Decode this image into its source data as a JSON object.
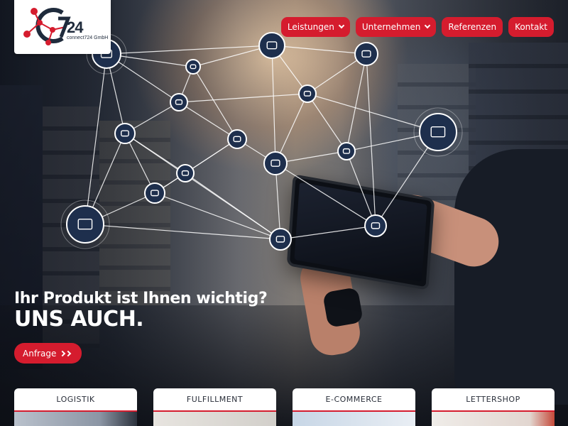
{
  "brand": {
    "logo_number": "24",
    "logo_subtitle": "connect724 GmbH",
    "logo_letters": "C7",
    "colors": {
      "accent": "#d51c2e",
      "navy": "#1f2b3c",
      "network_node": "#1e2f4d"
    }
  },
  "nav": {
    "items": [
      {
        "label": "Leistungen",
        "has_dropdown": true
      },
      {
        "label": "Unternehmen",
        "has_dropdown": true
      },
      {
        "label": "Referenzen",
        "has_dropdown": false
      },
      {
        "label": "Kontakt",
        "has_dropdown": false
      }
    ]
  },
  "hero": {
    "headline": "Ihr Produkt ist Ihnen wichtig?",
    "subline": "UNS AUCH.",
    "cta_label": "Anfrage",
    "network_icons": [
      "austria-map-icon",
      "thumbs-up-icon",
      "paper-plane-icon",
      "lightbulb-icon",
      "share-icon",
      "package-icon",
      "headset-icon",
      "delivery-truck-icon",
      "time-package-icon",
      "courier-icon",
      "shopping-cart-icon",
      "gift-icon",
      "team-icon",
      "goods-basket-icon",
      "warehouse-boxes-icon",
      "chart-icon"
    ]
  },
  "services": [
    {
      "title": "LOGISTIK"
    },
    {
      "title": "FULFILLMENT"
    },
    {
      "title": "E-COMMERCE"
    },
    {
      "title": "LETTERSHOP"
    }
  ]
}
